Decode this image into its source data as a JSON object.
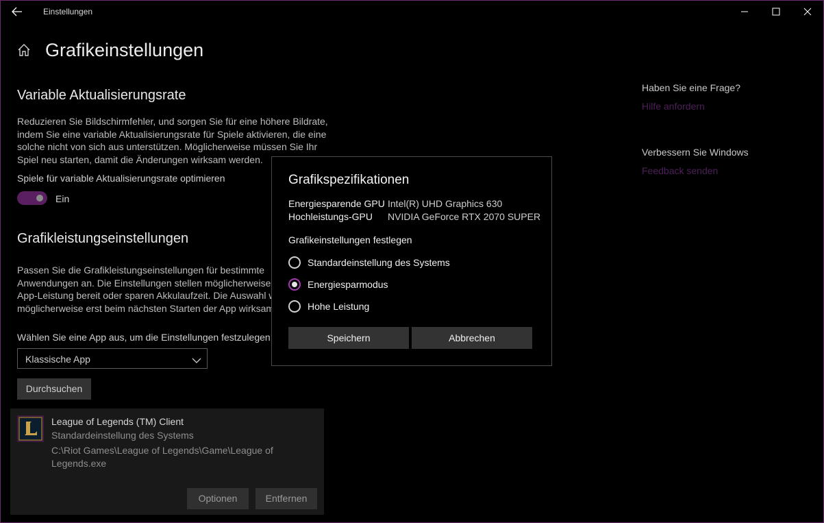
{
  "window": {
    "title": "Einstellungen"
  },
  "page": {
    "title": "Grafikeinstellungen"
  },
  "vrr": {
    "heading": "Variable Aktualisierungsrate",
    "description_lines": [
      "Reduzieren Sie Bildschirmfehler, und sorgen Sie für eine höhere Bildrate,",
      "indem Sie eine variable Aktualisierungsrate für Spiele aktivieren, die eine",
      "solche nicht von sich aus unterstützen. Möglicherweise müssen Sie Ihr",
      "Spiel neu starten, damit die Änderungen wirksam werden."
    ],
    "toggle_label": "Spiele für variable Aktualisierungsrate optimieren",
    "toggle_state": "Ein",
    "toggle_on": true
  },
  "perf": {
    "heading": "Grafikleistungseinstellungen",
    "description_lines": [
      "Passen Sie die Grafikleistungseinstellungen für bestimmte",
      "Anwendungen an. Die Einstellungen stellen möglicherweise e",
      "App-Leistung bereit oder sparen Akkulaufzeit. Die Auswahl w",
      "möglicherweise erst beim nächsten Starten der App wirksam"
    ],
    "choose_label": "Wählen Sie eine App aus, um die Einstellungen festzulegen.",
    "dropdown_value": "Klassische App",
    "browse_label": "Durchsuchen"
  },
  "app_card": {
    "name": "League of Legends (TM) Client",
    "mode": "Standardeinstellung des Systems",
    "path": "C:\\Riot Games\\League of Legends\\Game\\League of Legends.exe",
    "options_label": "Optionen",
    "remove_label": "Entfernen"
  },
  "sidebar": {
    "question_heading": "Haben Sie eine Frage?",
    "help_link": "Hilfe anfordern",
    "improve_heading": "Verbessern Sie Windows",
    "feedback_link": "Feedback senden"
  },
  "dialog": {
    "title": "Grafikspezifikationen",
    "specs": [
      {
        "key": "Energiesparende GPU",
        "value": "Intel(R) UHD Graphics 630"
      },
      {
        "key": "Hochleistungs-GPU",
        "value": "NVIDIA GeForce RTX 2070 SUPER"
      }
    ],
    "subheading": "Grafikeinstellungen festlegen",
    "options": [
      {
        "label": "Standardeinstellung des Systems",
        "selected": false
      },
      {
        "label": "Energiesparmodus",
        "selected": true
      },
      {
        "label": "Hohe Leistung",
        "selected": false
      }
    ],
    "save_label": "Speichern",
    "cancel_label": "Abbrechen"
  },
  "colors": {
    "accent": "#8b2f95",
    "link": "#4c2058",
    "background": "#000000"
  }
}
